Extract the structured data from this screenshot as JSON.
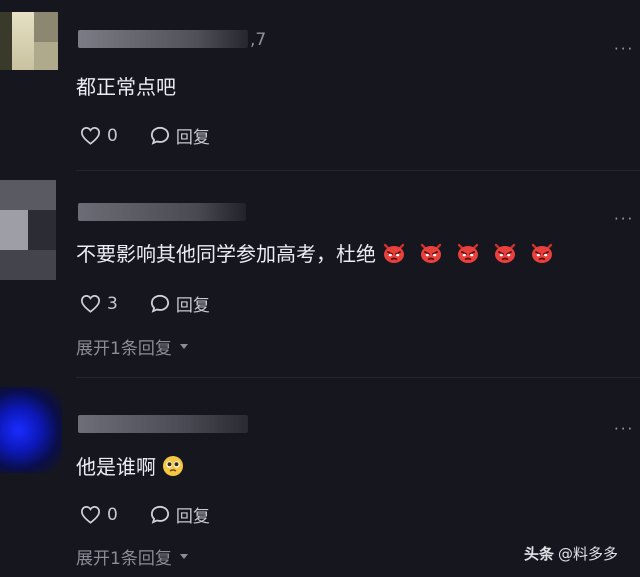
{
  "comments": [
    {
      "username_suffix": ",7",
      "text": "都正常点吧",
      "like_count": "0",
      "reply_label": "回复",
      "more_label": "···"
    },
    {
      "text": "不要影响其他同学参加高考，杜绝",
      "emoji": [
        "angry-face-emoji",
        "angry-face-emoji",
        "angry-face-emoji",
        "angry-face-emoji",
        "angry-face-emoji"
      ],
      "like_count": "3",
      "reply_label": "回复",
      "more_label": "···",
      "expand_label": "展开1条回复"
    },
    {
      "text": "他是谁啊",
      "emoji": [
        "pleading-face-emoji"
      ],
      "like_count": "0",
      "reply_label": "回复",
      "more_label": "···",
      "expand_label": "展开1条回复"
    }
  ],
  "watermark": {
    "brand": "头条",
    "account": "@料多多"
  }
}
